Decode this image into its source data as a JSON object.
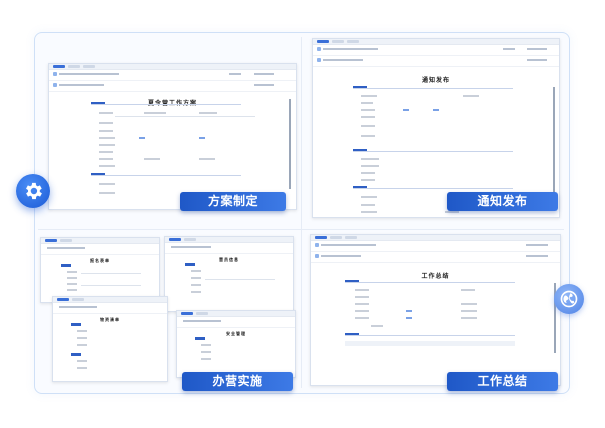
{
  "panels": [
    {
      "id": "plan",
      "caption": "方案制定",
      "doc_title": "夏令营工作方案"
    },
    {
      "id": "notice",
      "caption": "通知发布",
      "doc_title": "通知发布"
    },
    {
      "id": "operate",
      "caption": "办营实施",
      "doc_titles": [
        "报名表单",
        "营员信息",
        "物资清单",
        "安全管理"
      ]
    },
    {
      "id": "summary",
      "caption": "工作总结",
      "doc_title": "工作总结"
    }
  ],
  "icons": {
    "left_badge": "gear-icon",
    "right_badge": "globe-icon"
  },
  "colors": {
    "accent": "#1f58c7",
    "section": "#2f5fc4",
    "frame": "#cfe0f7"
  }
}
